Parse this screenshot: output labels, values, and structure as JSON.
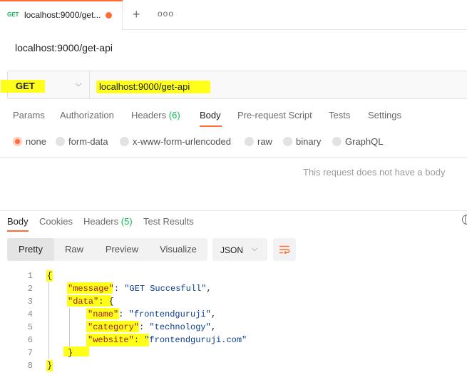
{
  "tab": {
    "method": "GET",
    "title": "localhost:9000/get..."
  },
  "request": {
    "name": "localhost:9000/get-api",
    "method": "GET",
    "url": "localhost:9000/get-api"
  },
  "request_tabs": [
    {
      "label": "Params"
    },
    {
      "label": "Authorization"
    },
    {
      "label": "Headers",
      "count": "(6)"
    },
    {
      "label": "Body"
    },
    {
      "label": "Pre-request Script"
    },
    {
      "label": "Tests"
    },
    {
      "label": "Settings"
    }
  ],
  "body_types": [
    "none",
    "form-data",
    "x-www-form-urlencoded",
    "raw",
    "binary",
    "GraphQL"
  ],
  "body_selected": "none",
  "no_body_text": "This request does not have a body",
  "response_tabs": [
    {
      "label": "Body"
    },
    {
      "label": "Cookies"
    },
    {
      "label": "Headers",
      "count": "(5)"
    },
    {
      "label": "Test Results"
    }
  ],
  "view_modes": [
    "Pretty",
    "Raw",
    "Preview",
    "Visualize"
  ],
  "format": "JSON",
  "code": {
    "line_numbers": [
      "1",
      "2",
      "3",
      "4",
      "5",
      "6",
      "7",
      "8"
    ],
    "open_brace": "{",
    "close_brace": "}",
    "message_key": "\"message\"",
    "message_val": "\"GET Succesfull\"",
    "data_key": "\"data\"",
    "data_open": "{",
    "name_key": "\"name\"",
    "name_val": "\"frontendguruji\"",
    "category_key": "\"category\"",
    "category_val": "\"technology\"",
    "website_key": "\"website\"",
    "website_val": "\"frontendguruji.com\"",
    "data_close": "}",
    "colon": ": ",
    "comma": ","
  },
  "colors": {
    "accent": "#ff6c37",
    "highlight": "#ffff1a",
    "count": "#0cbb52"
  }
}
